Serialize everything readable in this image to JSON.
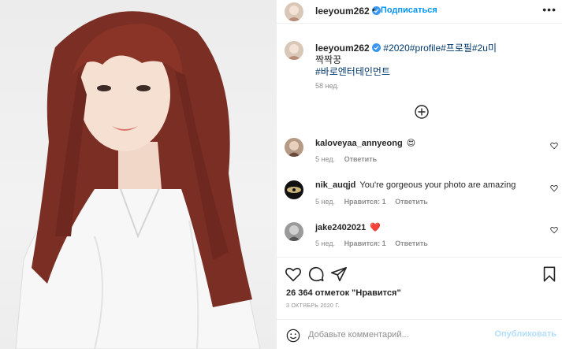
{
  "header": {
    "username": "leeyoum262",
    "dot": "•",
    "follow_label": "Подписаться",
    "more_icon": "more-dots-icon"
  },
  "caption": {
    "username": "leeyoum262",
    "tags_line1": "#2020#profile#프로필#2u미",
    "line2": "짝짝꿍",
    "tag_line3": "#바로엔터테인먼트",
    "time": "58 нед."
  },
  "load_more_icon": "plus-circle-icon",
  "comments": [
    {
      "username": "kaloveyaa_annyeong",
      "text": "😍",
      "time": "5 нед.",
      "likes": "",
      "reply": "Ответить"
    },
    {
      "username": "nik_auqjd",
      "text": "You're gorgeous your photo are amazing",
      "time": "5 нед.",
      "likes": "Нравится: 1",
      "reply": "Ответить"
    },
    {
      "username": "jake2402021",
      "text": "❤️",
      "time": "5 нед.",
      "likes": "Нравится: 1",
      "reply": "Ответить"
    }
  ],
  "stats": {
    "likes": "26 364 отметок \"Нравится\"",
    "date": "3 ОКТЯБРЬ 2020 Г."
  },
  "add_comment": {
    "placeholder": "Добавьте комментарий...",
    "publish_label": "Опубликовать"
  },
  "colors": {
    "link_blue": "#0095f6",
    "hashtag": "#00376b",
    "muted": "#8e8e8e",
    "publish_disabled": "#b2dffc"
  }
}
